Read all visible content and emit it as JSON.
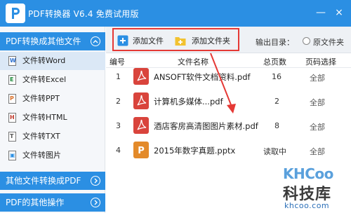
{
  "window": {
    "title": "PDF转换器 V6.4 免费试用版",
    "controls": [
      "—",
      "×"
    ]
  },
  "sidebar": {
    "section_main": "PDF转换成其他文件",
    "items": [
      {
        "label": "文件转Word",
        "icon": "word-file-icon",
        "glyph": "W",
        "color": "#2b6fcf",
        "active": true
      },
      {
        "label": "文件转Excel",
        "icon": "excel-file-icon",
        "glyph": "E",
        "color": "#1e8a3a",
        "active": false
      },
      {
        "label": "文件转PPT",
        "icon": "ppt-file-icon",
        "glyph": "P",
        "color": "#d9702a",
        "active": false
      },
      {
        "label": "文件转HTML",
        "icon": "html-file-icon",
        "glyph": "H",
        "color": "#c0392b",
        "active": false
      },
      {
        "label": "文件转TXT",
        "icon": "txt-file-icon",
        "glyph": "T",
        "color": "#555555",
        "active": false
      },
      {
        "label": "文件转图片",
        "icon": "image-file-icon",
        "glyph": "▣",
        "color": "#2b8fe3",
        "active": false
      }
    ],
    "section_other_to_pdf": "其他文件转换成PDF",
    "section_other_ops": "PDF的其他操作"
  },
  "toolbar": {
    "add_file": "添加文件",
    "add_folder": "添加文件夹",
    "output_label": "输出目录：",
    "original_folder": "原文件夹"
  },
  "table": {
    "headers": {
      "index": "编号",
      "name": "文件名称",
      "pages": "总页数",
      "range": "页码选择"
    },
    "rows": [
      {
        "index": "1",
        "name": "ANSOFT软件文档资料.pdf",
        "pages": "16",
        "range": "全部",
        "type": "pdf"
      },
      {
        "index": "2",
        "name": "计算机多媒体...pdf",
        "pages": "2",
        "range": "全部",
        "type": "pdf"
      },
      {
        "index": "3",
        "name": "酒店客房高清图图片素材.pdf",
        "pages": "8",
        "range": "全部",
        "type": "pdf"
      },
      {
        "index": "4",
        "name": "2015年数字真题.pptx",
        "pages": "读取中",
        "range": "全部",
        "type": "ppt"
      }
    ]
  },
  "watermark": {
    "logo": "KHCoo",
    "name": "科技库",
    "domain": "khcoo.com"
  },
  "colors": {
    "accent": "#2b8fe3",
    "highlight_frame": "#e53935",
    "pdf_icon": "#d9443c",
    "ppt_icon": "#e38a2a"
  }
}
